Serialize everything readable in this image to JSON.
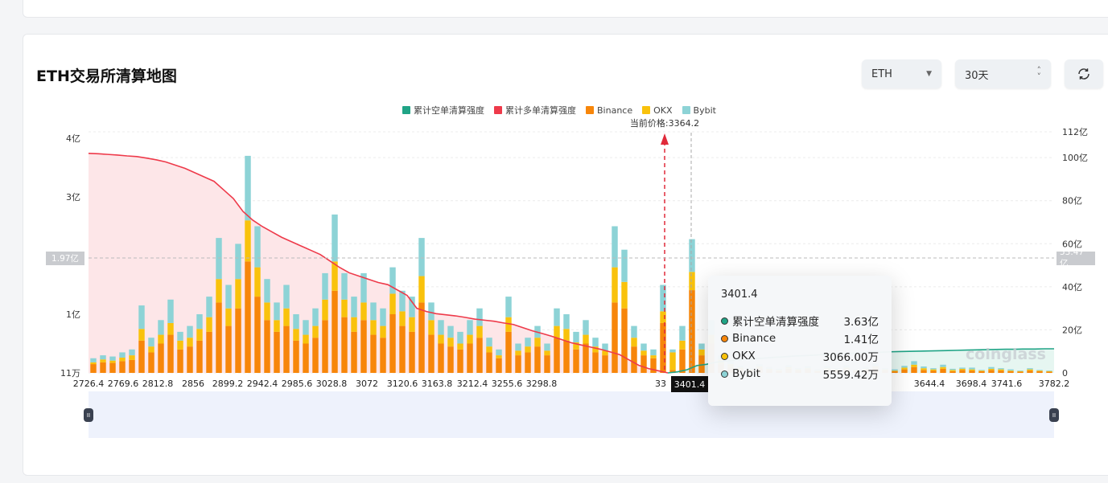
{
  "header": {
    "title": "ETH交易所清算地图",
    "coin_select": "ETH",
    "range_select": "30天",
    "refresh_icon": "refresh-icon"
  },
  "colors": {
    "short": "#20a486",
    "long": "#ee3a4a",
    "binance": "#f7860a",
    "okx": "#f9c20c",
    "bybit": "#8dd3d6"
  },
  "legend": [
    "累计空单清算强度",
    "累计多单清算强度",
    "Binance",
    "OKX",
    "Bybit"
  ],
  "current_price_label": "当前价格:3364.2",
  "watermark": "coinglass",
  "crosshair": {
    "x_label": "3401.4",
    "left_y_label": "1.97亿",
    "right_y_label": "53.47亿"
  },
  "tooltip": {
    "title": "3401.4",
    "rows": [
      {
        "name": "累计空单清算强度",
        "value": "3.63亿",
        "color": "#20a486"
      },
      {
        "name": "Binance",
        "value": "1.41亿",
        "color": "#f7860a"
      },
      {
        "name": "OKX",
        "value": "3066.00万",
        "color": "#f9c20c"
      },
      {
        "name": "Bybit",
        "value": "5559.42万",
        "color": "#8dd3d6"
      }
    ]
  },
  "chart_data": {
    "type": "bar",
    "title": "ETH交易所清算地图",
    "left_axis": {
      "unit": "亿",
      "range": [
        0,
        4
      ],
      "tick_labels": [
        "11万",
        "1亿",
        "3亿",
        "4亿"
      ],
      "tick_values": [
        0,
        1,
        3,
        4
      ]
    },
    "right_axis": {
      "unit": "亿",
      "range": [
        0,
        112
      ],
      "tick_labels": [
        "0",
        "20亿",
        "40亿",
        "60亿",
        "80亿",
        "100亿",
        "112亿"
      ],
      "tick_values": [
        0,
        20,
        40,
        60,
        80,
        100,
        112
      ]
    },
    "x_tick_labels": [
      "2726.4",
      "2769.6",
      "2812.8",
      "2856",
      "2899.2",
      "2942.4",
      "2985.6",
      "3028.8",
      "3072",
      "3120.6",
      "3163.8",
      "3212.4",
      "3255.6",
      "3298.8",
      "33",
      "3644.4",
      "3698.4",
      "3741.6",
      "3782.2"
    ],
    "current_price": 3364.2,
    "series_order": [
      "Binance",
      "OKX",
      "Bybit"
    ],
    "bars_binance_okx_bybit": [
      [
        0.15,
        0.03,
        0.07
      ],
      [
        0.18,
        0.05,
        0.07
      ],
      [
        0.17,
        0.04,
        0.07
      ],
      [
        0.2,
        0.06,
        0.09
      ],
      [
        0.22,
        0.08,
        0.1
      ],
      [
        0.55,
        0.2,
        0.4
      ],
      [
        0.35,
        0.1,
        0.15
      ],
      [
        0.5,
        0.15,
        0.25
      ],
      [
        0.65,
        0.2,
        0.4
      ],
      [
        0.4,
        0.15,
        0.15
      ],
      [
        0.45,
        0.15,
        0.2
      ],
      [
        0.55,
        0.2,
        0.25
      ],
      [
        0.7,
        0.25,
        0.35
      ],
      [
        1.2,
        0.4,
        0.7
      ],
      [
        0.8,
        0.3,
        0.4
      ],
      [
        1.1,
        0.5,
        0.6
      ],
      [
        1.9,
        0.7,
        1.1
      ],
      [
        1.3,
        0.5,
        0.7
      ],
      [
        0.9,
        0.3,
        0.4
      ],
      [
        0.7,
        0.2,
        0.3
      ],
      [
        0.8,
        0.3,
        0.4
      ],
      [
        0.55,
        0.2,
        0.25
      ],
      [
        0.5,
        0.15,
        0.25
      ],
      [
        0.6,
        0.2,
        0.3
      ],
      [
        0.9,
        0.35,
        0.45
      ],
      [
        1.4,
        0.5,
        0.8
      ],
      [
        0.95,
        0.3,
        0.45
      ],
      [
        0.7,
        0.25,
        0.35
      ],
      [
        0.9,
        0.3,
        0.5
      ],
      [
        0.65,
        0.25,
        0.3
      ],
      [
        0.6,
        0.2,
        0.3
      ],
      [
        1.0,
        0.35,
        0.45
      ],
      [
        0.8,
        0.25,
        0.35
      ],
      [
        0.7,
        0.25,
        0.35
      ],
      [
        1.2,
        0.45,
        0.65
      ],
      [
        0.65,
        0.25,
        0.3
      ],
      [
        0.5,
        0.15,
        0.25
      ],
      [
        0.45,
        0.15,
        0.2
      ],
      [
        0.4,
        0.1,
        0.2
      ],
      [
        0.5,
        0.15,
        0.25
      ],
      [
        0.6,
        0.2,
        0.3
      ],
      [
        0.35,
        0.1,
        0.15
      ],
      [
        0.25,
        0.05,
        0.1
      ],
      [
        0.7,
        0.25,
        0.35
      ],
      [
        0.3,
        0.08,
        0.12
      ],
      [
        0.35,
        0.1,
        0.15
      ],
      [
        0.45,
        0.15,
        0.2
      ],
      [
        0.3,
        0.08,
        0.12
      ],
      [
        0.6,
        0.2,
        0.3
      ],
      [
        0.55,
        0.2,
        0.25
      ],
      [
        0.4,
        0.12,
        0.18
      ],
      [
        0.5,
        0.15,
        0.25
      ],
      [
        0.35,
        0.1,
        0.15
      ],
      [
        0.3,
        0.08,
        0.12
      ],
      [
        1.2,
        0.6,
        0.7
      ],
      [
        1.1,
        0.45,
        0.55
      ],
      [
        0.45,
        0.15,
        0.2
      ],
      [
        0.3,
        0.08,
        0.12
      ],
      [
        0.25,
        0.05,
        0.1
      ],
      [
        0.85,
        0.2,
        0.45
      ],
      [
        0.05,
        0.3,
        0.05
      ],
      [
        0.4,
        0.15,
        0.25
      ],
      [
        1.41,
        0.31,
        0.56
      ],
      [
        0.3,
        0.1,
        0.1
      ],
      [
        0.5,
        0.15,
        0.25
      ],
      [
        0.15,
        0.08,
        0.07
      ],
      [
        0.1,
        0.05,
        0.05
      ],
      [
        0.06,
        0.03,
        0.03
      ],
      [
        0.04,
        0.02,
        0.02
      ],
      [
        0.08,
        0.03,
        0.04
      ],
      [
        0.05,
        0.02,
        0.03
      ],
      [
        0.03,
        0.02,
        0.02
      ],
      [
        0.07,
        0.03,
        0.03
      ],
      [
        0.04,
        0.02,
        0.02
      ],
      [
        0.06,
        0.02,
        0.03
      ],
      [
        0.03,
        0.01,
        0.02
      ],
      [
        0.05,
        0.03,
        0.03
      ],
      [
        0.04,
        0.02,
        0.02
      ],
      [
        0.06,
        0.03,
        0.04
      ],
      [
        0.03,
        0.02,
        0.01
      ],
      [
        0.05,
        0.02,
        0.03
      ],
      [
        0.08,
        0.03,
        0.05
      ],
      [
        0.04,
        0.02,
        0.02
      ],
      [
        0.03,
        0.01,
        0.02
      ],
      [
        0.06,
        0.03,
        0.03
      ],
      [
        0.1,
        0.04,
        0.06
      ],
      [
        0.05,
        0.03,
        0.03
      ],
      [
        0.04,
        0.02,
        0.02
      ],
      [
        0.07,
        0.03,
        0.04
      ],
      [
        0.03,
        0.02,
        0.02
      ],
      [
        0.05,
        0.02,
        0.02
      ],
      [
        0.04,
        0.02,
        0.03
      ],
      [
        0.03,
        0.01,
        0.01
      ],
      [
        0.05,
        0.02,
        0.03
      ],
      [
        0.04,
        0.02,
        0.02
      ],
      [
        0.03,
        0.01,
        0.02
      ],
      [
        0.02,
        0.01,
        0.01
      ],
      [
        0.04,
        0.02,
        0.02
      ],
      [
        0.03,
        0.01,
        0.01
      ],
      [
        0.02,
        0.01,
        0.01
      ]
    ],
    "cumulative_long": [
      102,
      101.8,
      101.5,
      101.2,
      100.8,
      100.5,
      99.8,
      99,
      98,
      96.5,
      95,
      93,
      91,
      89,
      85,
      81,
      75,
      71,
      68,
      65.5,
      63,
      61,
      59,
      57,
      55,
      52,
      49,
      46.5,
      45,
      43.5,
      42,
      41,
      38.5,
      36,
      30,
      28.5,
      27.5,
      27,
      26.5,
      25.8,
      25,
      24.5,
      24,
      23.2,
      22.5,
      21,
      19.5,
      18.3,
      17,
      15.5,
      14,
      13,
      12,
      11,
      9.8,
      8.5,
      6,
      3.5,
      2,
      1,
      0
    ],
    "cumulative_short": [
      0,
      0.5,
      1.5,
      3.4,
      4,
      5,
      5.5,
      6,
      6.3,
      6.6,
      6.9,
      7.2,
      7.5,
      7.8,
      8,
      8.2,
      8.5,
      8.7,
      8.9,
      9.1,
      9.3,
      9.5,
      9.6,
      9.8,
      9.9,
      10,
      10.1,
      10.2,
      10.3,
      10.4,
      10.5,
      10.6,
      10.7,
      10.8,
      10.9,
      11,
      11,
      11.1,
      11.1,
      11.2,
      11.2
    ]
  }
}
